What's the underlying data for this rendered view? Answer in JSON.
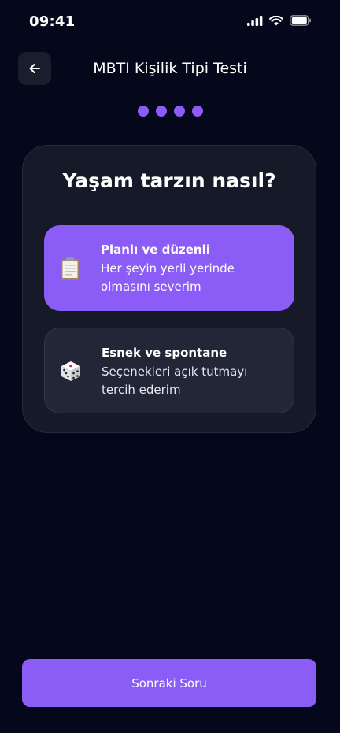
{
  "status_bar": {
    "time": "09:41"
  },
  "header": {
    "title": "MBTI Kişilik Tipi Testi"
  },
  "progress": {
    "total_steps": 4,
    "completed_steps": 4
  },
  "question": {
    "title": "Yaşam tarzın nasıl?",
    "options": [
      {
        "title": "Planlı ve düzenli",
        "description": "Her şeyin yerli yerinde olmasını severim",
        "icon": "clipboard-icon",
        "selected": true
      },
      {
        "title": "Esnek ve spontane",
        "description": "Seçenekleri açık tutmayı tercih ederim",
        "icon": "dice-icon",
        "selected": false
      }
    ]
  },
  "footer": {
    "next_label": "Sonraki Soru"
  },
  "colors": {
    "background": "#05081a",
    "accent": "#8b5cf6",
    "card": "#161927",
    "option_default": "#232636"
  }
}
